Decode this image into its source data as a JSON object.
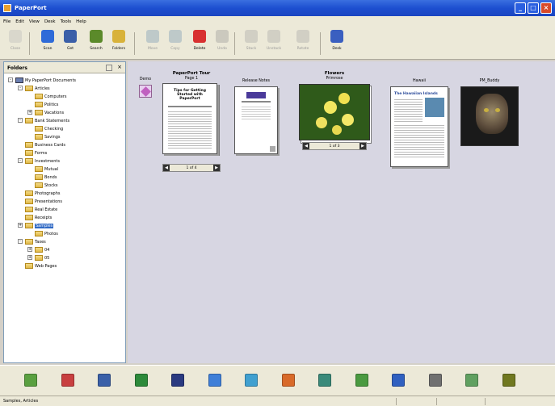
{
  "window": {
    "title": "PaperPort"
  },
  "menu": [
    "File",
    "Edit",
    "View",
    "Desk",
    "Tools",
    "Help"
  ],
  "toolbar": [
    {
      "label": "Close",
      "icon": "close-doc-icon",
      "color": "#b8b8b8",
      "disabled": true
    },
    {
      "label": "Scan",
      "icon": "scan-icon",
      "color": "#2f6bd8",
      "disabled": false
    },
    {
      "label": "Get",
      "icon": "get-icon",
      "color": "#3b5fa8",
      "disabled": false
    },
    {
      "label": "Search",
      "icon": "search-icon",
      "color": "#5b8a2a",
      "disabled": false
    },
    {
      "label": "Folders",
      "icon": "folders-icon",
      "color": "#d8b23a",
      "disabled": false
    },
    {
      "label": "Move",
      "icon": "move-icon",
      "color": "#6a8fb0",
      "disabled": true
    },
    {
      "label": "Copy",
      "icon": "copy-icon",
      "color": "#6a8fb0",
      "disabled": true
    },
    {
      "label": "Delete",
      "icon": "delete-icon",
      "color": "#d83030",
      "disabled": false
    },
    {
      "label": "Undo",
      "icon": "undo-icon",
      "color": "#909090",
      "disabled": true
    },
    {
      "label": "Stack",
      "icon": "stack-icon",
      "color": "#a0a0a0",
      "disabled": true
    },
    {
      "label": "Unstack",
      "icon": "unstack-icon",
      "color": "#a0a0a0",
      "disabled": true
    },
    {
      "label": "Rotate",
      "icon": "rotate-icon",
      "color": "#a0a0a0",
      "disabled": true
    },
    {
      "label": "Desk",
      "icon": "desk-view-icon",
      "color": "#3a5fc0",
      "disabled": false
    }
  ],
  "folder_pane": {
    "title": "Folders"
  },
  "tree": [
    {
      "label": "My PaperPort Documents",
      "level": 0,
      "type": "root",
      "expander": "-"
    },
    {
      "label": "Articles",
      "level": 1,
      "type": "folder",
      "expander": "-"
    },
    {
      "label": "Computers",
      "level": 2,
      "type": "folder",
      "expander": ""
    },
    {
      "label": "Politics",
      "level": 2,
      "type": "folder",
      "expander": ""
    },
    {
      "label": "Vacations",
      "level": 2,
      "type": "folder",
      "expander": "+"
    },
    {
      "label": "Bank Statements",
      "level": 1,
      "type": "folder",
      "expander": "-"
    },
    {
      "label": "Checking",
      "level": 2,
      "type": "folder",
      "expander": ""
    },
    {
      "label": "Savings",
      "level": 2,
      "type": "folder",
      "expander": ""
    },
    {
      "label": "Business Cards",
      "level": 1,
      "type": "folder",
      "expander": ""
    },
    {
      "label": "Forms",
      "level": 1,
      "type": "folder",
      "expander": ""
    },
    {
      "label": "Investments",
      "level": 1,
      "type": "folder",
      "expander": "-"
    },
    {
      "label": "Mutual",
      "level": 2,
      "type": "folder",
      "expander": ""
    },
    {
      "label": "Bonds",
      "level": 2,
      "type": "folder",
      "expander": ""
    },
    {
      "label": "Stocks",
      "level": 2,
      "type": "folder",
      "expander": ""
    },
    {
      "label": "Photographs",
      "level": 1,
      "type": "folder",
      "expander": ""
    },
    {
      "label": "Presentations",
      "level": 1,
      "type": "folder",
      "expander": ""
    },
    {
      "label": "Real Estate",
      "level": 1,
      "type": "folder",
      "expander": ""
    },
    {
      "label": "Receipts",
      "level": 1,
      "type": "folder",
      "expander": ""
    },
    {
      "label": "Samples",
      "level": 1,
      "type": "folder",
      "expander": "+",
      "selected": true
    },
    {
      "label": "Photos",
      "level": 2,
      "type": "folder",
      "expander": ""
    },
    {
      "label": "Taxes",
      "level": 1,
      "type": "folder",
      "expander": "-"
    },
    {
      "label": "04",
      "level": 2,
      "type": "folder",
      "expander": "+"
    },
    {
      "label": "05",
      "level": 2,
      "type": "folder",
      "expander": "+"
    },
    {
      "label": "Web Pages",
      "level": 1,
      "type": "folder",
      "expander": ""
    }
  ],
  "desktop": {
    "items": [
      {
        "top": "Demo",
        "sub": "",
        "kind": "icon"
      },
      {
        "top": "PaperPort Tour",
        "sub": "Page 1",
        "kind": "stack",
        "nav": "1 of 4"
      },
      {
        "top": "Release Notes",
        "sub": "",
        "kind": "doc"
      },
      {
        "top": "Flowers",
        "sub": "Primrose",
        "kind": "photo-stack",
        "nav": "1 of 3"
      },
      {
        "top": "Hawaii",
        "sub": "",
        "kind": "web"
      },
      {
        "top": "PM_Buddy",
        "sub": "",
        "kind": "cat"
      }
    ],
    "doc_text": {
      "tour_heading": "Tips for Getting Started with PaperPort",
      "web_heading": "The Hawaiian Islands"
    }
  },
  "launcher": [
    {
      "name": "app-icon-1",
      "color": "#5aa040"
    },
    {
      "name": "app-icon-2",
      "color": "#c84040"
    },
    {
      "name": "app-icon-3",
      "color": "#3a60a8"
    },
    {
      "name": "excel-icon",
      "color": "#2d8a3a"
    },
    {
      "name": "app-icon-5",
      "color": "#2a3a80"
    },
    {
      "name": "word-icon",
      "color": "#3f7fd8"
    },
    {
      "name": "app-icon-7",
      "color": "#40a0d0"
    },
    {
      "name": "powerpoint-icon",
      "color": "#d86a2a"
    },
    {
      "name": "globe-icon",
      "color": "#3a8a7a"
    },
    {
      "name": "app-icon-10",
      "color": "#4a9a40"
    },
    {
      "name": "app-icon-11",
      "color": "#3060c0"
    },
    {
      "name": "printer-icon",
      "color": "#707070"
    },
    {
      "name": "recycle-bin-icon",
      "color": "#60a060"
    },
    {
      "name": "app-icon-14",
      "color": "#707820"
    }
  ],
  "status": {
    "text": "Samples, Articles"
  }
}
